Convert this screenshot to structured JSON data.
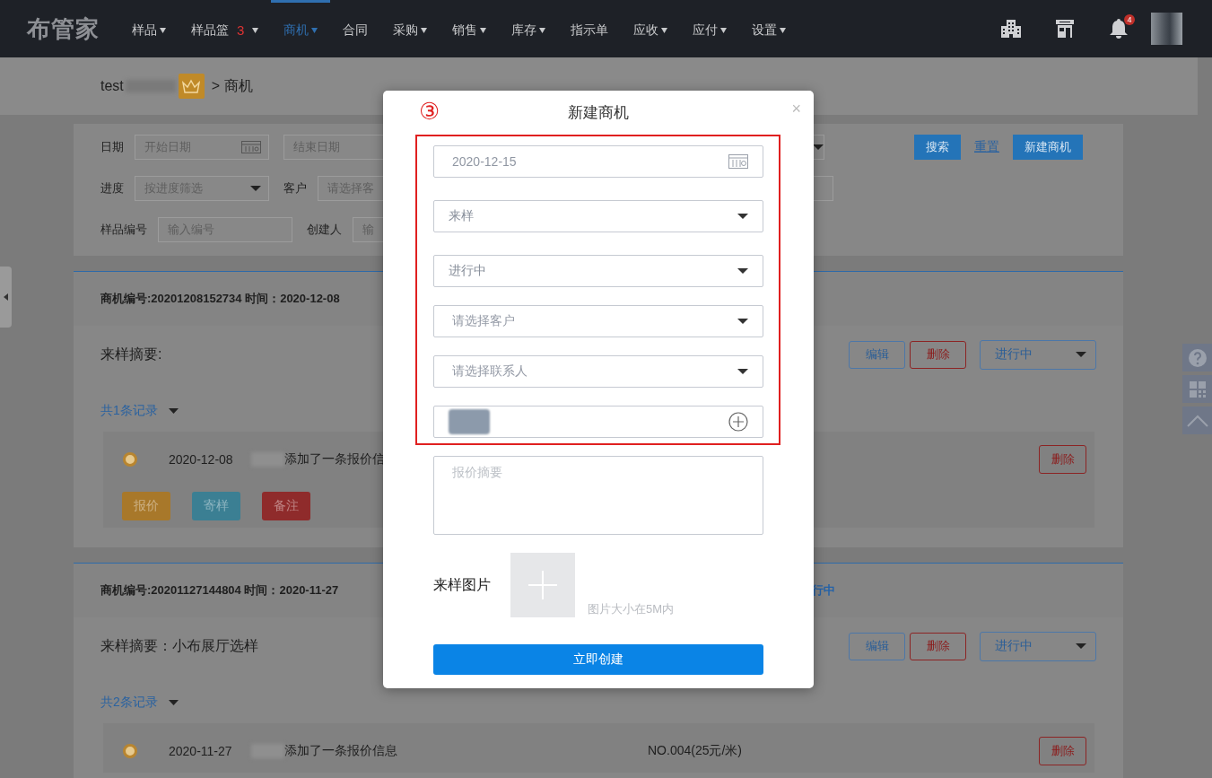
{
  "nav": {
    "logo": "布管家",
    "items": [
      {
        "label": "样品",
        "dropdown": true,
        "selected": false
      },
      {
        "label": "样品篮",
        "badge": "3",
        "dropdown": true,
        "selected": false
      },
      {
        "label": "商机",
        "dropdown": true,
        "selected": true
      },
      {
        "label": "合同",
        "dropdown": false,
        "selected": false
      },
      {
        "label": "采购",
        "dropdown": true,
        "selected": false
      },
      {
        "label": "销售",
        "dropdown": true,
        "selected": false
      },
      {
        "label": "库存",
        "dropdown": true,
        "selected": false
      },
      {
        "label": "指示单",
        "dropdown": false,
        "selected": false
      },
      {
        "label": "应收",
        "dropdown": true,
        "selected": false
      },
      {
        "label": "应付",
        "dropdown": true,
        "selected": false
      },
      {
        "label": "设置",
        "dropdown": true,
        "selected": false
      }
    ],
    "notification_count": "4"
  },
  "breadcrumb": {
    "user": "test",
    "separator": ">",
    "current": "商机"
  },
  "filters": {
    "rows": [
      {
        "items": [
          {
            "kind": "label",
            "text": "日期"
          },
          {
            "kind": "date",
            "placeholder": "开始日期"
          },
          {
            "kind": "input",
            "placeholder": "结束日期"
          },
          {
            "kind": "select"
          }
        ]
      },
      {
        "items": [
          {
            "kind": "label",
            "text": "进度"
          },
          {
            "kind": "select",
            "placeholder": "按进度筛选"
          },
          {
            "kind": "label",
            "text": "客户"
          },
          {
            "kind": "input",
            "placeholder": "请选择客"
          },
          {
            "kind": "input"
          }
        ]
      },
      {
        "items": [
          {
            "kind": "label",
            "text": "样品编号"
          },
          {
            "kind": "input",
            "placeholder": "输入编号"
          },
          {
            "kind": "label",
            "text": "创建人"
          },
          {
            "kind": "input",
            "placeholder": "输"
          }
        ]
      }
    ],
    "buttons": [
      {
        "label": "搜索",
        "kind": "primary"
      },
      {
        "label": "重置",
        "kind": "link"
      },
      {
        "label": "新建商机",
        "kind": "primary"
      }
    ]
  },
  "records": [
    {
      "header": "商机编号:20201208152734  时间：2020-12-08",
      "summary": "来样摘要:",
      "actions": [
        "编辑",
        "删除"
      ],
      "status": "进行中",
      "history": "共1条记录",
      "entries": [
        {
          "date": "2020-12-08",
          "text": "添加了一条报价信",
          "button": "删除"
        }
      ],
      "entry_buttons": [
        {
          "label": "报价",
          "color": "#a8782a"
        },
        {
          "label": "寄样",
          "color": "#3b7f93"
        },
        {
          "label": "备注",
          "color": "#8f2b2b"
        }
      ]
    },
    {
      "header": "商机编号:20201127144804  时间：2020-11-27",
      "status_link": "行中",
      "summary": "来样摘要：小布展厅选样",
      "actions": [
        "编辑",
        "删除"
      ],
      "status": "进行中",
      "history": "共2条记录",
      "entries": [
        {
          "date": "2020-11-27",
          "text": "添加了一条报价信息",
          "detail": "NO.004(25元/米)",
          "button": "删除"
        }
      ]
    }
  ],
  "modal": {
    "annotation": "③",
    "title": "新建商机",
    "close": "×",
    "fields": [
      {
        "kind": "date",
        "value": "2020-12-15"
      },
      {
        "kind": "select",
        "value": "来样"
      },
      {
        "kind": "select",
        "value": "进行中"
      },
      {
        "kind": "select",
        "placeholder": "请选择客户"
      },
      {
        "kind": "select",
        "placeholder": "请选择联系人"
      },
      {
        "kind": "sample"
      }
    ],
    "summary_placeholder": "报价摘要",
    "image_label": "来样图片",
    "image_hint": "图片大小在5M内",
    "submit": "立即创建"
  }
}
